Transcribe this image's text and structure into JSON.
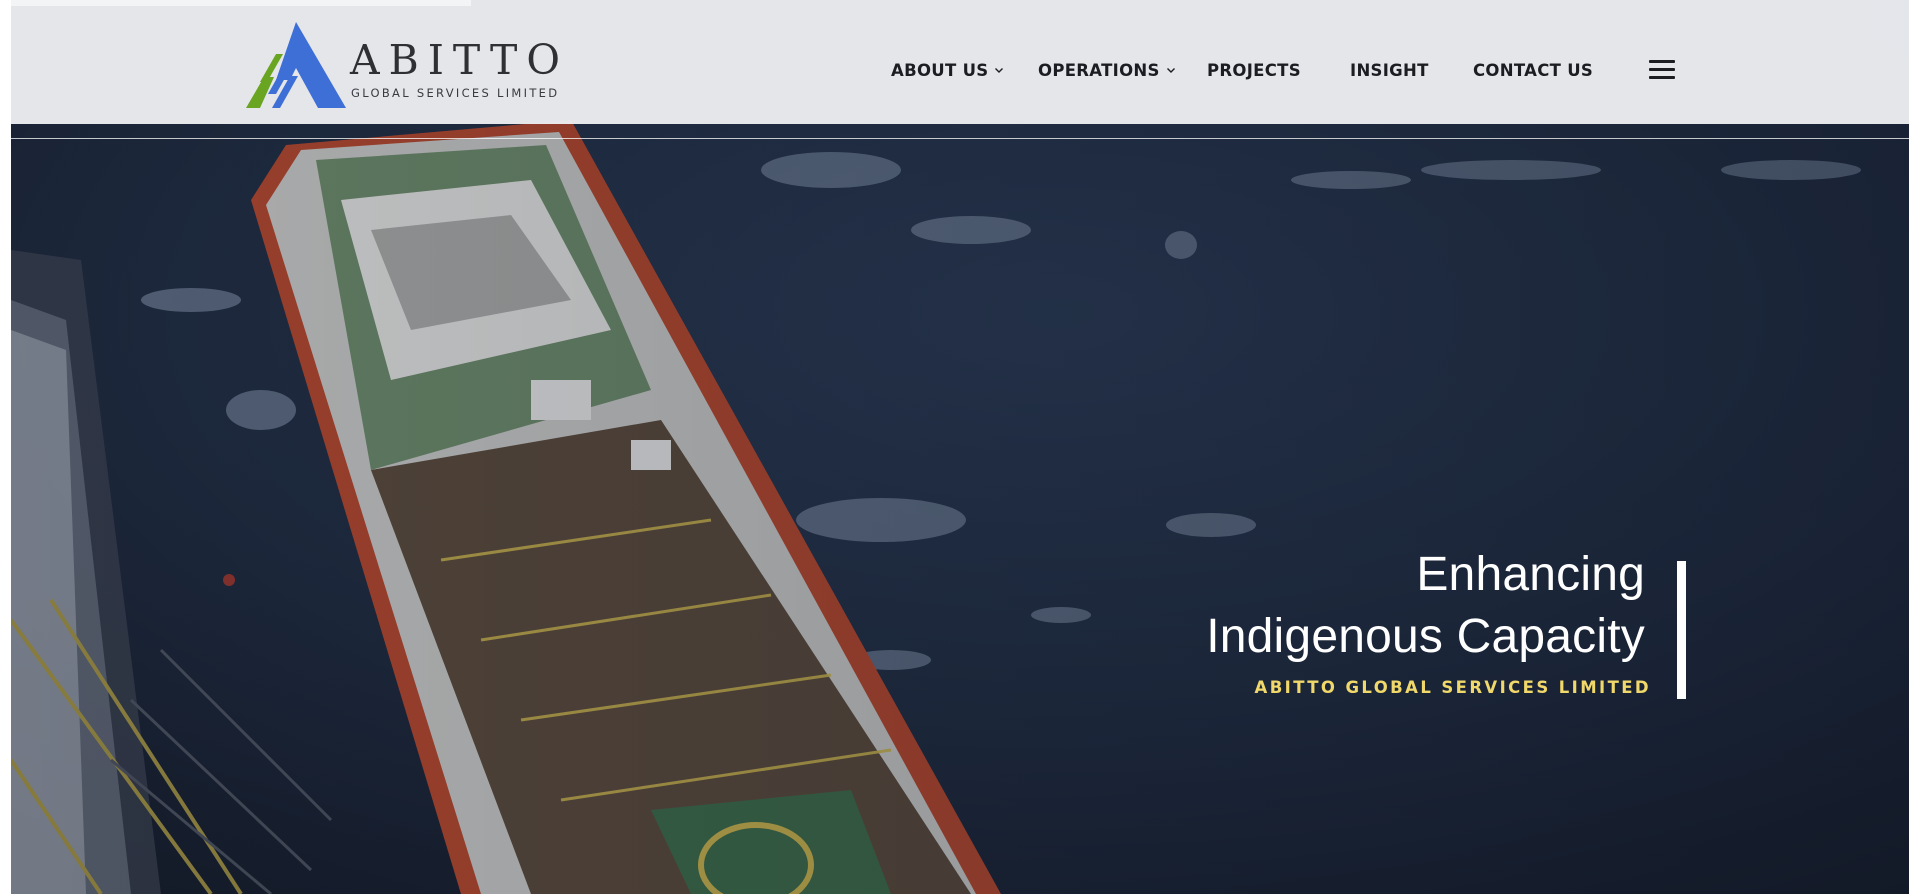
{
  "brand": {
    "name": "ABITTO",
    "tagline": "GLOBAL SERVICES LIMITED",
    "colors": {
      "blue": "#3d6fd6",
      "green": "#6aa521",
      "text": "#2f3033"
    }
  },
  "nav": {
    "items": [
      {
        "label": "ABOUT US",
        "has_dropdown": true
      },
      {
        "label": "OPERATIONS",
        "has_dropdown": true
      },
      {
        "label": "PROJECTS",
        "has_dropdown": false
      },
      {
        "label": "INSIGHT",
        "has_dropdown": false
      },
      {
        "label": "CONTACT US",
        "has_dropdown": false
      }
    ],
    "menu_icon": "hamburger-menu-icon"
  },
  "hero": {
    "title_line1": "Enhancing",
    "title_line2": "Indigenous Capacity",
    "subtitle": "ABITTO GLOBAL SERVICES LIMITED",
    "subtitle_color": "#f1d86a",
    "background": "aerial view of a supply vessel beside an offshore platform on dark sea"
  }
}
